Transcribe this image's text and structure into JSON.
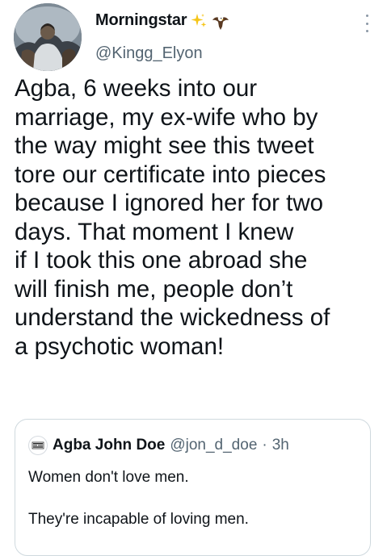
{
  "author": {
    "display_name": "Morningstar",
    "handle": "@Kingg_Elyon",
    "name_emojis": [
      "sparkles-icon",
      "eagle-icon"
    ]
  },
  "tweet": {
    "lines": [
      "Agba, 6 weeks into our",
      "marriage, my ex-wife who by",
      "the way might see this tweet",
      "tore our certificate into pieces",
      "because I ignored her for two",
      "days. That moment I knew",
      "if I took this one abroad she",
      "will finish me, people don’t",
      "understand the wickedness of",
      "a psychotic woman!"
    ]
  },
  "quoted_tweet": {
    "display_name": "Agba John Doe",
    "handle": "@jon_d_doe",
    "separator": "·",
    "time": "3h",
    "paragraphs": [
      "Women don't love men.",
      "They're incapable of loving men."
    ]
  },
  "colors": {
    "text": "#0f1419",
    "secondary": "#536471",
    "border": "#cfd9de",
    "sparkle": "#f5c518"
  }
}
